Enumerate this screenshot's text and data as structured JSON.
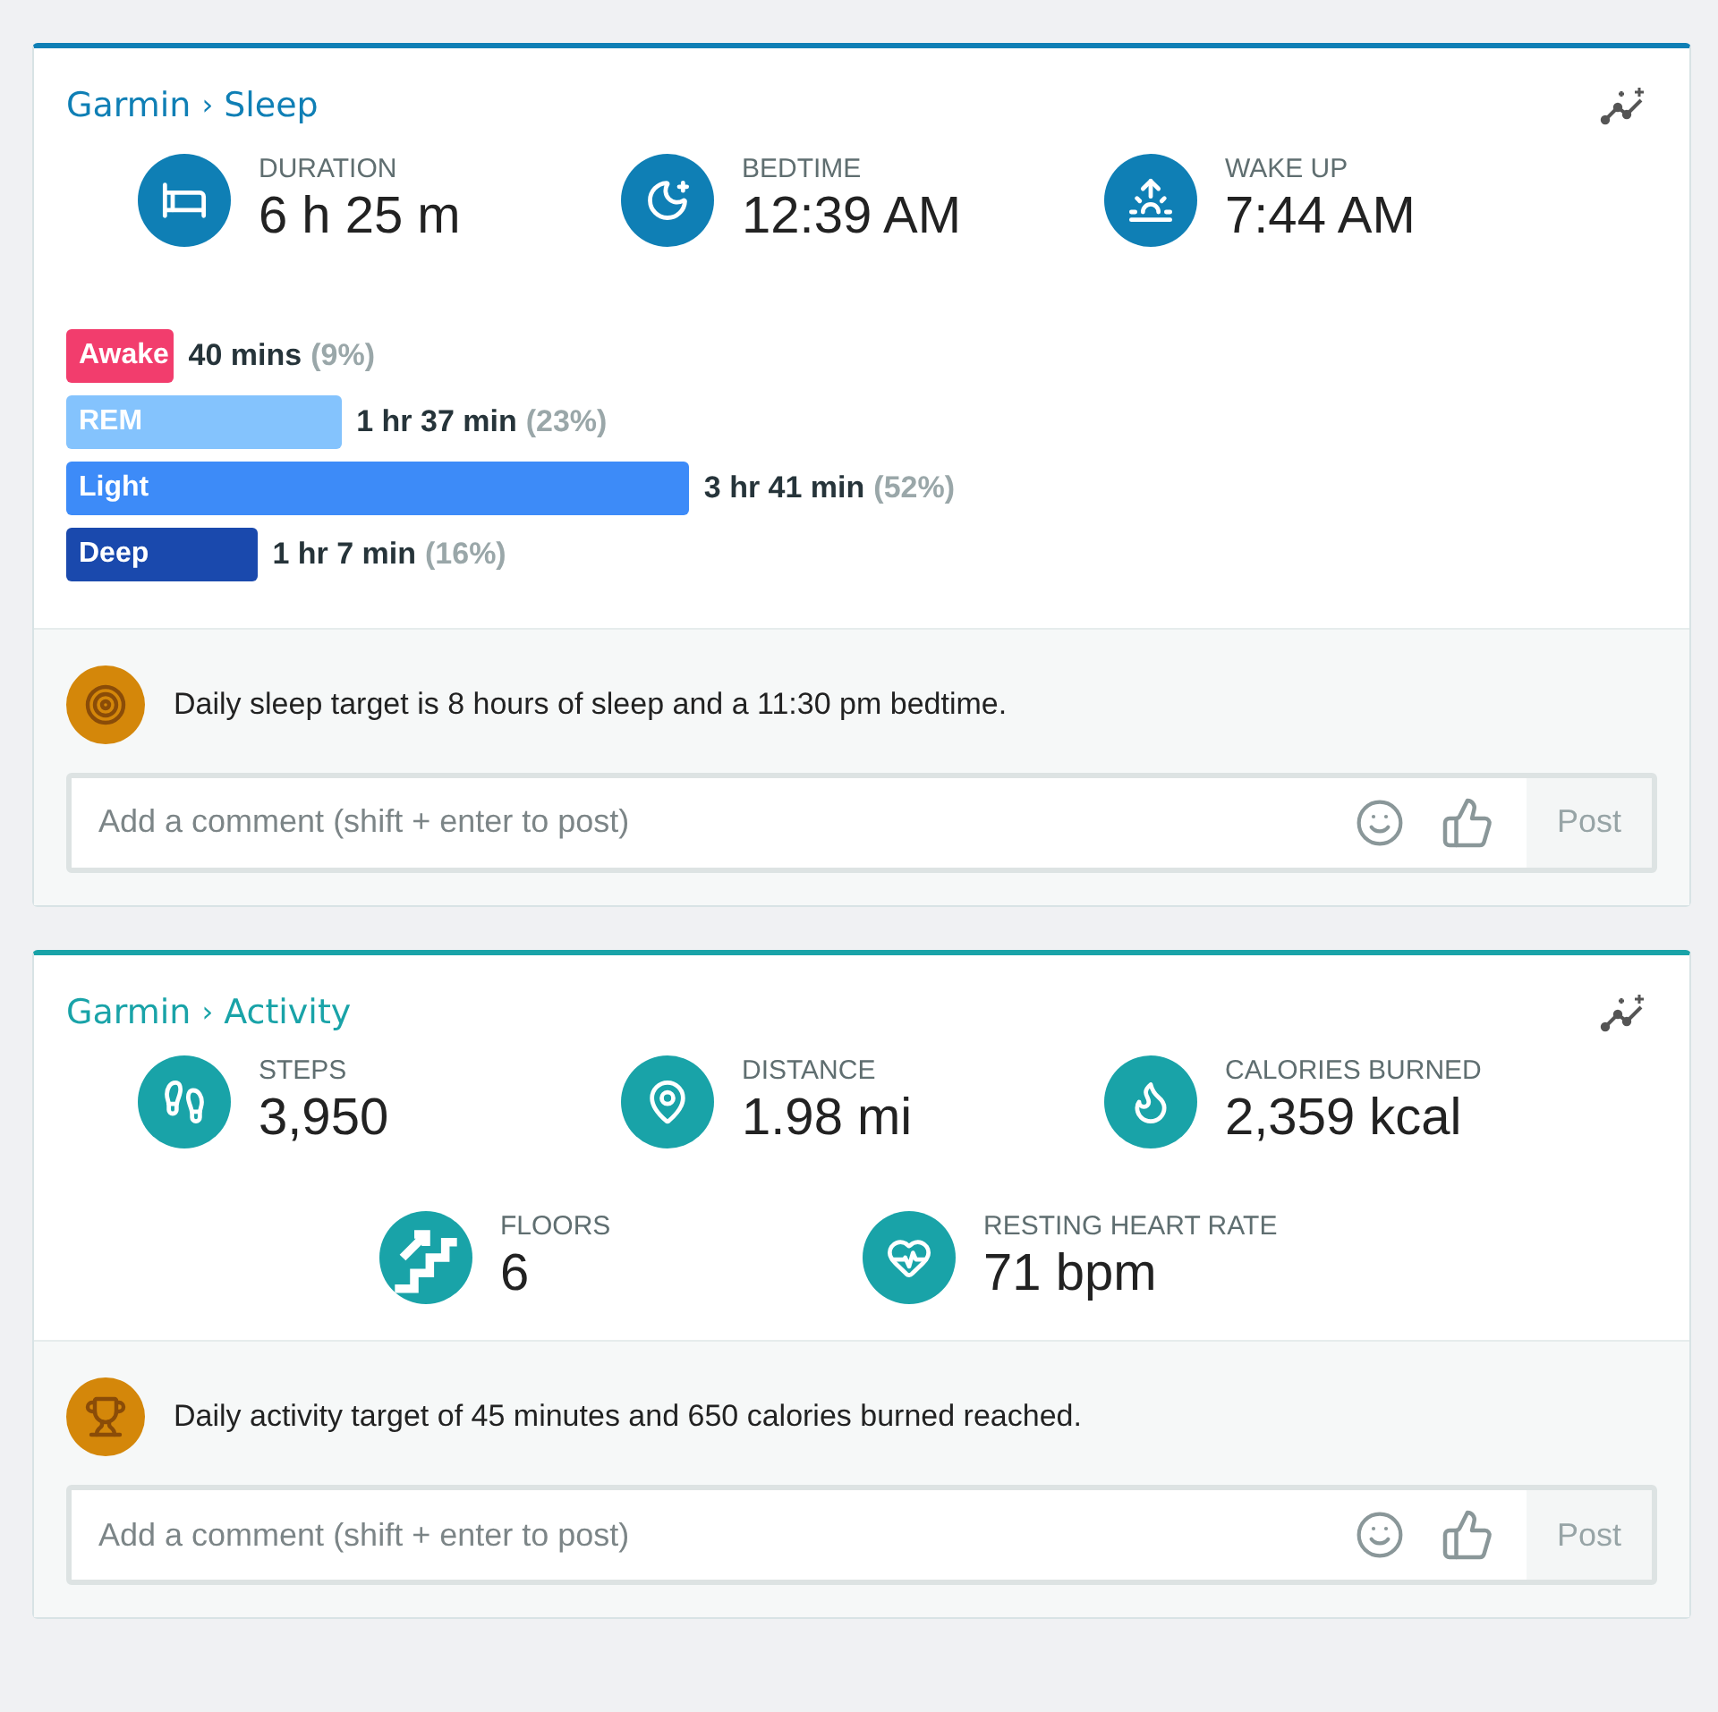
{
  "cards": [
    {
      "kind": "sleep",
      "source": "Garmin",
      "separator": "›",
      "title": "Sleep",
      "metric_rows": [
        [
          {
            "kind": "duration",
            "label": "DURATION",
            "value": "6 h 25 m"
          },
          {
            "kind": "bedtime",
            "label": "BEDTIME",
            "value": "12:39 AM"
          },
          {
            "kind": "wake",
            "label": "WAKE UP",
            "value": "7:44 AM"
          }
        ]
      ],
      "stages": [
        {
          "label": "Awake",
          "duration": "40 mins",
          "percent": "(9%)",
          "color": "#f23d6d"
        },
        {
          "label": "REM",
          "duration": "1 hr 37 min",
          "percent": "(23%)",
          "color": "#84c3fd"
        },
        {
          "label": "Light",
          "duration": "3 hr 41 min",
          "percent": "(52%)",
          "color": "#3d8bf8"
        },
        {
          "label": "Deep",
          "duration": "1 hr 7 min",
          "percent": "(16%)",
          "color": "#1a49ad"
        }
      ],
      "goal": {
        "kind": "target",
        "text": "Daily sleep target is 8 hours of sleep and a 11:30 pm bedtime."
      },
      "comment": {
        "placeholder": "Add a comment (shift + enter to post)",
        "button": "Post"
      }
    },
    {
      "kind": "activity",
      "source": "Garmin",
      "separator": "›",
      "title": "Activity",
      "metric_rows": [
        [
          {
            "kind": "steps",
            "label": "STEPS",
            "value": "3,950"
          },
          {
            "kind": "distance",
            "label": "DISTANCE",
            "value": "1.98 mi"
          },
          {
            "kind": "calories",
            "label": "CALORIES BURNED",
            "value": "2,359 kcal"
          }
        ],
        [
          {
            "kind": "floors",
            "label": "FLOORS",
            "value": "6"
          },
          {
            "kind": "heart",
            "label": "RESTING HEART RATE",
            "value": "71 bpm"
          }
        ]
      ],
      "goal": {
        "kind": "trophy",
        "text": "Daily activity target of 45 minutes and 650 calories burned reached."
      },
      "comment": {
        "placeholder": "Add a comment (shift + enter to post)",
        "button": "Post"
      }
    }
  ]
}
